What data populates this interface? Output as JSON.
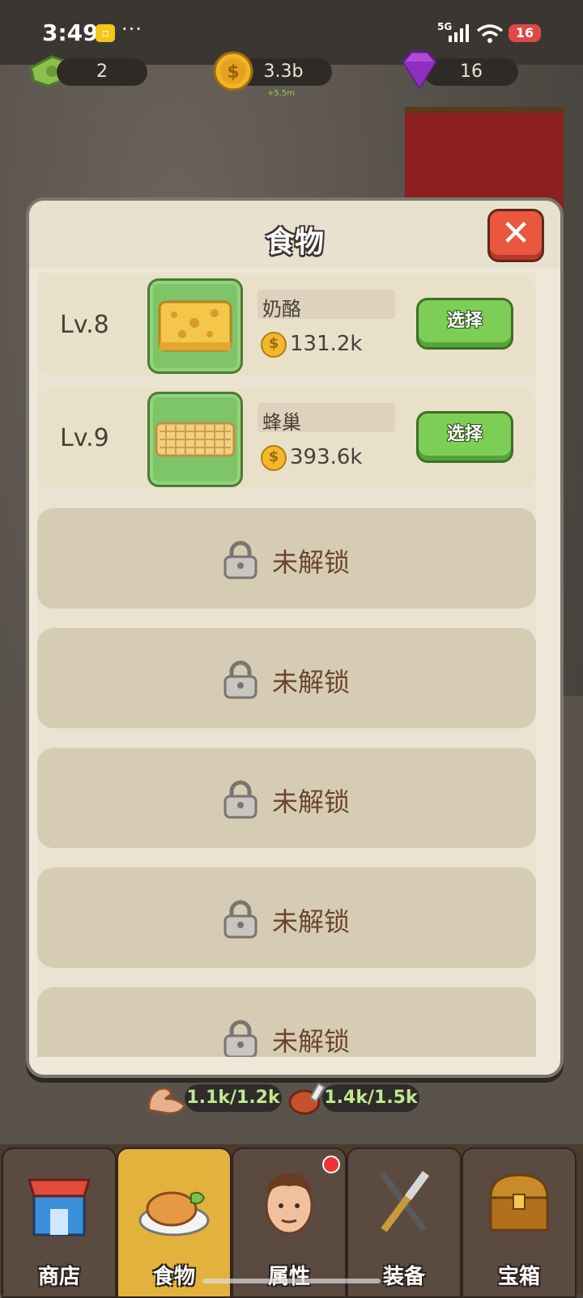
{
  "status_bar": {
    "time": "3:49",
    "network": "5G",
    "battery": "16",
    "more": "···"
  },
  "resources": {
    "cash": "2",
    "gold": "3.3b",
    "gold_income": "+5.5m",
    "gems": "16"
  },
  "modal": {
    "title": "食物",
    "close_icon": "close-x-icon",
    "unlocked_items": [
      {
        "level": "Lv.8",
        "name": "奶酪",
        "price": "131.2k",
        "button": "选择",
        "icon": "cheese-icon"
      },
      {
        "level": "Lv.9",
        "name": "蜂巢",
        "price": "393.6k",
        "button": "选择",
        "icon": "honeycomb-icon"
      }
    ],
    "locked_label": "未解锁",
    "locked_count": 5
  },
  "stats": {
    "strength": "1.1k/1.2k",
    "food": "1.4k/1.5k"
  },
  "nav": [
    {
      "label": "商店",
      "icon": "shop-icon",
      "active": false
    },
    {
      "label": "食物",
      "icon": "food-plate-icon",
      "active": true
    },
    {
      "label": "属性",
      "icon": "avatar-icon",
      "active": false,
      "notification": true
    },
    {
      "label": "装备",
      "icon": "fork-knife-icon",
      "active": false
    },
    {
      "label": "宝箱",
      "icon": "treasure-chest-icon",
      "active": false
    }
  ],
  "colors": {
    "select_green": "#7cce56",
    "close_red": "#e8573e",
    "active_tab": "#e3b23c"
  }
}
